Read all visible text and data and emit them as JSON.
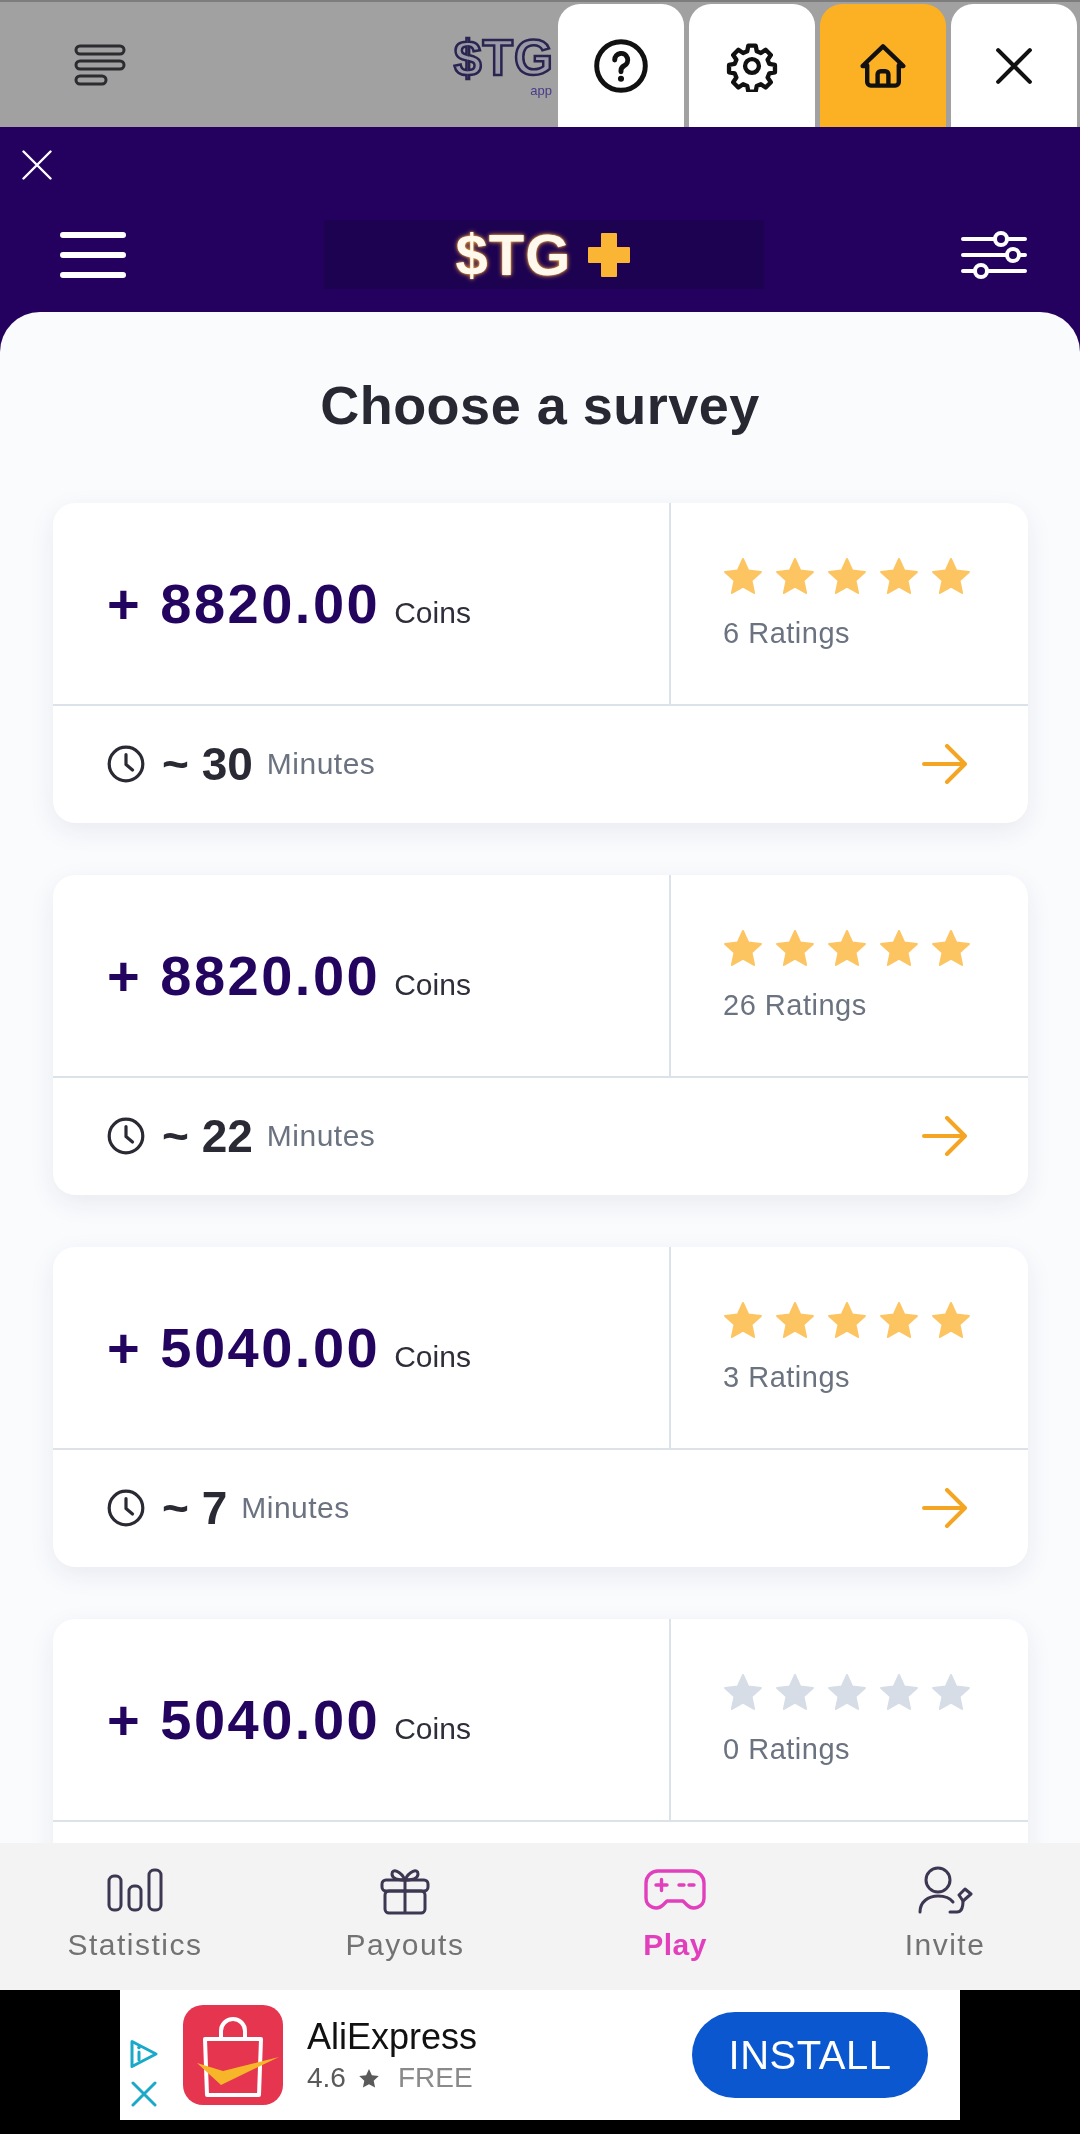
{
  "top_bar": {
    "logo_text": "$TG",
    "logo_tagline": "app",
    "buttons": [
      {
        "kind": "help",
        "selected": false
      },
      {
        "kind": "settings",
        "selected": false
      },
      {
        "kind": "home",
        "selected": true
      },
      {
        "kind": "close",
        "selected": false
      }
    ]
  },
  "header": {
    "logo_text": "$TG"
  },
  "page_title": "Choose a survey",
  "surveys": [
    {
      "amount": "+ 8820.00",
      "unit": "Coins",
      "stars": 5,
      "ratings": "6 Ratings",
      "duration": "~ 30",
      "duration_unit": "Minutes"
    },
    {
      "amount": "+ 8820.00",
      "unit": "Coins",
      "stars": 5,
      "ratings": "26 Ratings",
      "duration": "~ 22",
      "duration_unit": "Minutes"
    },
    {
      "amount": "+ 5040.00",
      "unit": "Coins",
      "stars": 5,
      "ratings": "3 Ratings",
      "duration": "~ 7",
      "duration_unit": "Minutes"
    },
    {
      "amount": "+ 5040.00",
      "unit": "Coins",
      "stars": 0,
      "ratings": "0 Ratings"
    }
  ],
  "bottom_nav": [
    {
      "kind": "statistics",
      "label": "Statistics",
      "selected": false
    },
    {
      "kind": "payouts",
      "label": "Payouts",
      "selected": false
    },
    {
      "kind": "play",
      "label": "Play",
      "selected": true
    },
    {
      "kind": "invite",
      "label": "Invite",
      "selected": false
    }
  ],
  "ad": {
    "app_name": "AliExpress",
    "rating": "4.6",
    "price": "FREE",
    "button": "INSTALL"
  }
}
